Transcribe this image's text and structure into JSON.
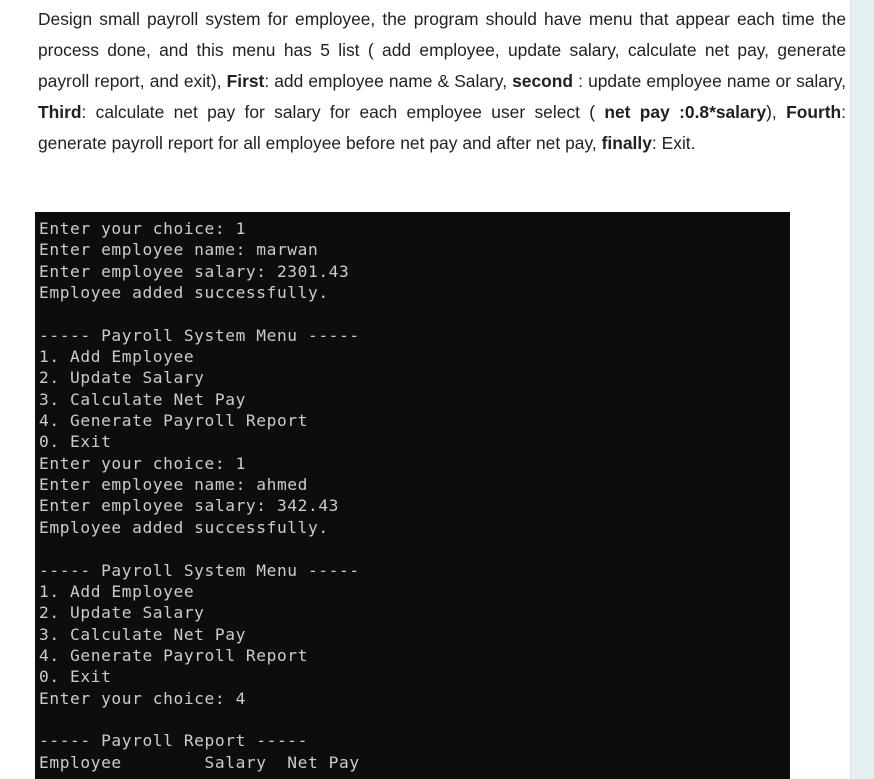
{
  "document": {
    "paragraph": [
      {
        "text": "Design small payroll system for employee, the program should have menu that appear each time the process done, and this menu has 5 list ( add employee, update salary, calculate net pay, generate payroll report, and exit), ",
        "bold": false
      },
      {
        "text": "First",
        "bold": true
      },
      {
        "text": ": add employee name & Salary, ",
        "bold": false
      },
      {
        "text": "second",
        "bold": true
      },
      {
        "text": " : update employee name or salary, ",
        "bold": false
      },
      {
        "text": "Third",
        "bold": true
      },
      {
        "text": ": calculate net pay for salary for each employee user select ( ",
        "bold": false
      },
      {
        "text": "net pay :0.8*salary",
        "bold": true
      },
      {
        "text": "), ",
        "bold": false
      },
      {
        "text": "Fourth",
        "bold": true
      },
      {
        "text": ": generate payroll report for all employee before net pay and after net pay, ",
        "bold": false
      },
      {
        "text": "finally",
        "bold": true
      },
      {
        "text": ": Exit.",
        "bold": false
      }
    ]
  },
  "console": {
    "background_color": "#0d0d0d",
    "text_color": "#cccccc",
    "lines": [
      "Enter your choice: 1",
      "Enter employee name: marwan",
      "Enter employee salary: 2301.43",
      "Employee added successfully.",
      "",
      "----- Payroll System Menu -----",
      "1. Add Employee",
      "2. Update Salary",
      "3. Calculate Net Pay",
      "4. Generate Payroll Report",
      "0. Exit",
      "Enter your choice: 1",
      "Enter employee name: ahmed",
      "Enter employee salary: 342.43",
      "Employee added successfully.",
      "",
      "----- Payroll System Menu -----",
      "1. Add Employee",
      "2. Update Salary",
      "3. Calculate Net Pay",
      "4. Generate Payroll Report",
      "0. Exit",
      "Enter your choice: 4",
      "",
      "----- Payroll Report -----",
      "Employee        Salary  Net Pay"
    ]
  },
  "right_strip": {
    "color": "#e4f0f2"
  }
}
